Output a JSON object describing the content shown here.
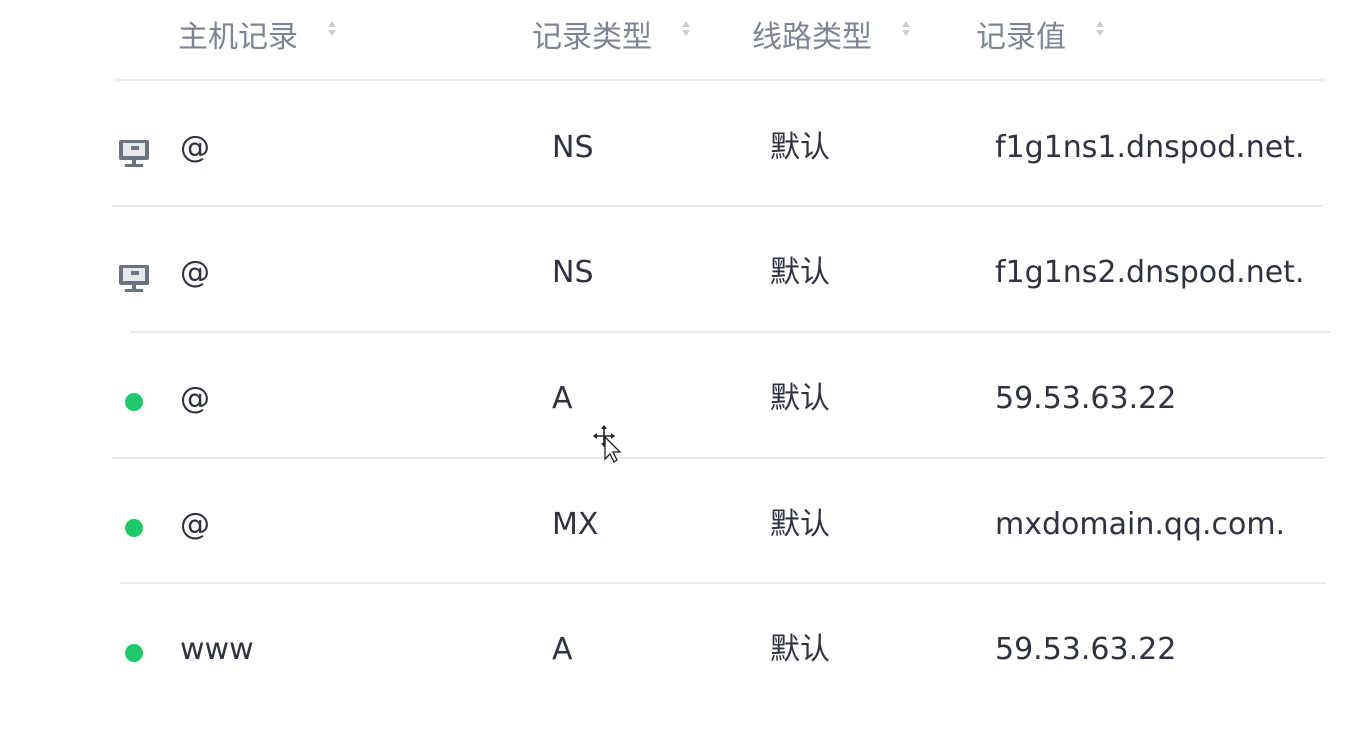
{
  "columns": [
    {
      "label": "主机记录"
    },
    {
      "label": "记录类型"
    },
    {
      "label": "线路类型"
    },
    {
      "label": "记录值"
    }
  ],
  "records": [
    {
      "status": "monitor-icon",
      "host": "@",
      "type": "NS",
      "line": "默认",
      "value": "f1g1ns1.dnspod.net."
    },
    {
      "status": "monitor-icon",
      "host": "@",
      "type": "NS",
      "line": "默认",
      "value": "f1g1ns2.dnspod.net."
    },
    {
      "status": "enabled-dot-icon",
      "host": "@",
      "type": "A",
      "line": "默认",
      "value": "59.53.63.22"
    },
    {
      "status": "enabled-dot-icon",
      "host": "@",
      "type": "MX",
      "line": "默认",
      "value": "mxdomain.qq.com."
    },
    {
      "status": "enabled-dot-icon",
      "host": "www",
      "type": "A",
      "line": "默认",
      "value": "59.53.63.22"
    }
  ],
  "colors": {
    "header_text": "#7d8494",
    "body_text": "#2f3340",
    "divider": "#e8eaee",
    "enabled_dot": "#1fc86a",
    "monitor_icon": "#6b7280"
  }
}
